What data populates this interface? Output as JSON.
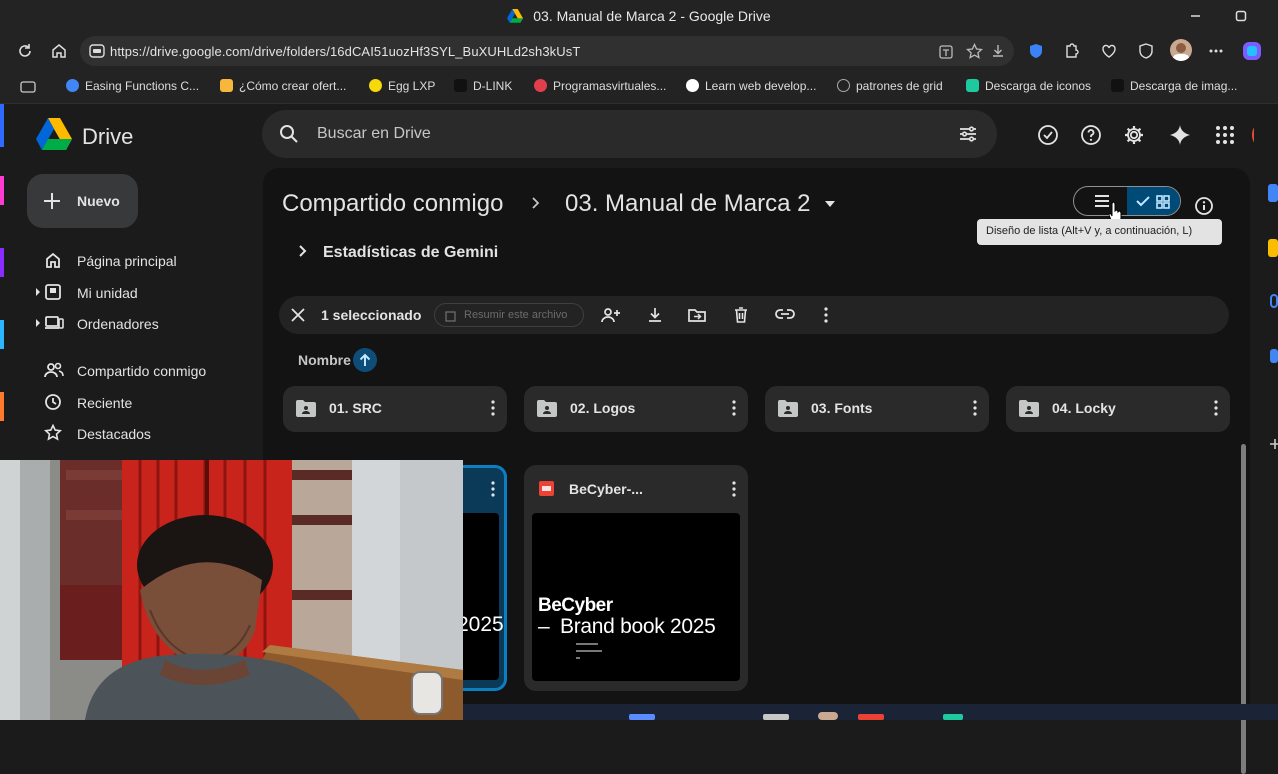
{
  "window": {
    "title": "03. Manual de Marca 2 - Google Drive"
  },
  "browser": {
    "url": "https://drive.google.com/drive/folders/16dCAI51uozHf3SYL_BuXUHLd2sh3kUsT",
    "bookmarks": [
      {
        "label": "Easing Functions C...",
        "color": "#4285f4"
      },
      {
        "label": "¿Cómo crear ofert...",
        "color": "#f6b73c"
      },
      {
        "label": "Egg LXP",
        "color": "#f5d90a"
      },
      {
        "label": "D-LINK",
        "color": "#1f1f1f"
      },
      {
        "label": "Programasvirtuales...",
        "color": "#e23f4c"
      },
      {
        "label": "Learn web develop...",
        "color": "#ffffff"
      },
      {
        "label": "patrones de grid",
        "color": "#9aa0a6"
      },
      {
        "label": "Descarga de iconos",
        "color": "#1fc9a0"
      },
      {
        "label": "Descarga de imag...",
        "color": "#1f1f1f"
      }
    ]
  },
  "drive": {
    "app_name": "Drive",
    "search_placeholder": "Buscar en Drive",
    "new_button": "Nuevo",
    "nav": [
      {
        "label": "Página principal"
      },
      {
        "label": "Mi unidad"
      },
      {
        "label": "Ordenadores"
      },
      {
        "label": "Compartido conmigo"
      },
      {
        "label": "Reciente"
      },
      {
        "label": "Destacados"
      }
    ],
    "breadcrumb": {
      "parent": "Compartido conmigo",
      "current": "03. Manual de Marca 2"
    },
    "tooltip": "Diseño de lista (Alt+V y, a continuación, L)",
    "gemini_stats": "Estadísticas de Gemini",
    "selection": {
      "count_label": "1 seleccionado",
      "summarize_label": "Resumir este archivo"
    },
    "sort_label": "Nombre",
    "folders": [
      {
        "name": "01. SRC"
      },
      {
        "name": "02. Logos"
      },
      {
        "name": "03. Fonts"
      },
      {
        "name": "04. Locky"
      }
    ],
    "files": [
      {
        "name": "BeCyber-...",
        "thumb_title": "BeCyber",
        "thumb_subtitle": "Brand book 2025",
        "thumb_dash": "–"
      },
      {
        "partial_thumb_text": "2025"
      }
    ],
    "colors": {
      "accent": "#0b57d0",
      "selected_border": "#0b7fc2",
      "pdf_red": "#ea4335"
    }
  }
}
